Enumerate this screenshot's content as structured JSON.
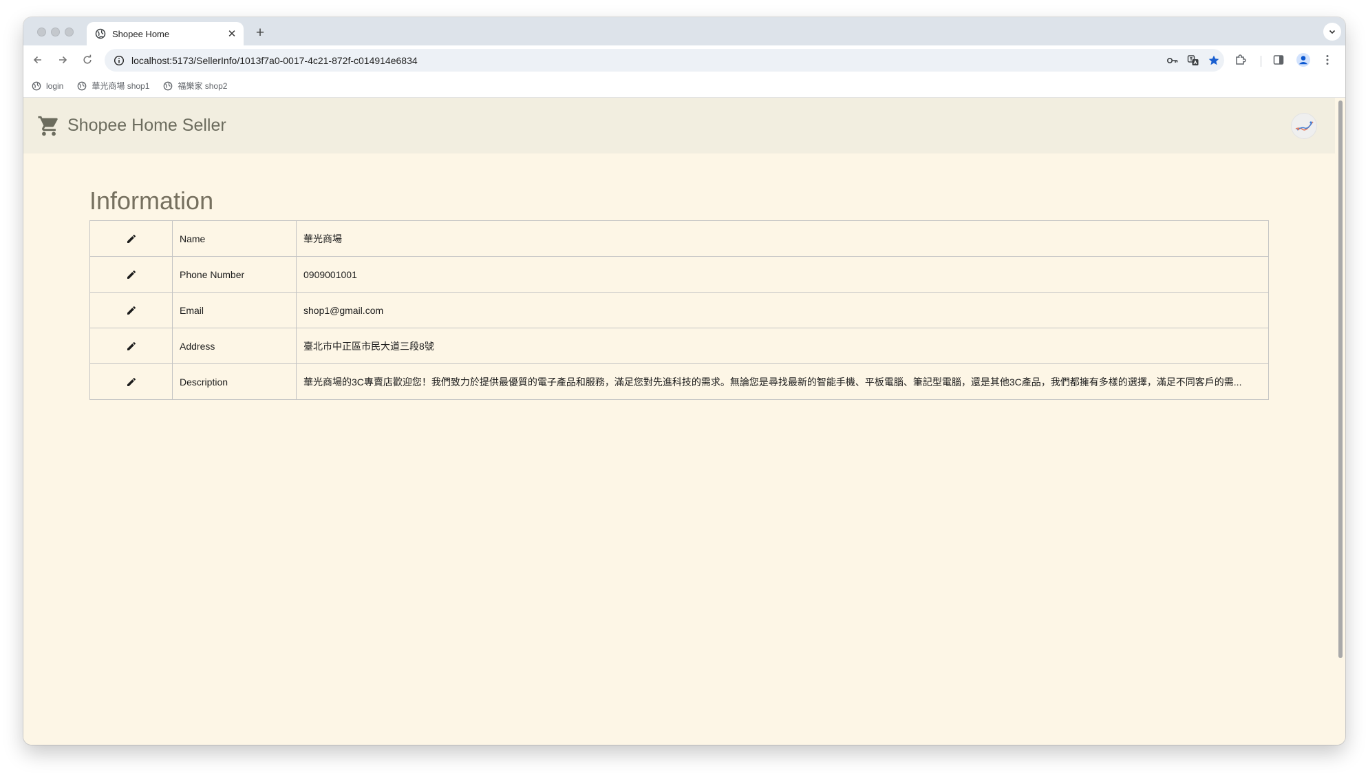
{
  "browser": {
    "tab": {
      "title": "Shopee Home",
      "close": "✕"
    },
    "new_tab": "+",
    "address": {
      "url": "localhost:5173/SellerInfo/1013f7a0-0017-4c21-872f-c014914e6834"
    },
    "bookmarks": [
      {
        "label": "login"
      },
      {
        "label": "華光商場 shop1"
      },
      {
        "label": "福樂家 shop2"
      }
    ]
  },
  "app": {
    "title": "Shopee Home Seller",
    "icons": {
      "brand": "cart-icon",
      "edit": "pencil-icon",
      "avatar": "user-avatar"
    }
  },
  "info": {
    "heading": "Information",
    "rows": [
      {
        "label": "Name",
        "value": "華光商場"
      },
      {
        "label": "Phone Number",
        "value": "0909001001"
      },
      {
        "label": "Email",
        "value": "shop1@gmail.com"
      },
      {
        "label": "Address",
        "value": "臺北市中正區市民大道三段8號"
      },
      {
        "label": "Description",
        "value": "華光商場的3C專賣店歡迎您！我們致力於提供最優質的電子產品和服務，滿足您對先進科技的需求。無論您是尋找最新的智能手機、平板電腦、筆記型電腦，還是其他3C產品，我們都擁有多樣的選擇，滿足不同客戶的需..."
      }
    ]
  },
  "colors": {
    "page_background": "#fdf6e6",
    "appbar_background": "#f2eee0",
    "brand_text": "#6c6c5e",
    "bookmark_star": "#1a5fd0"
  }
}
